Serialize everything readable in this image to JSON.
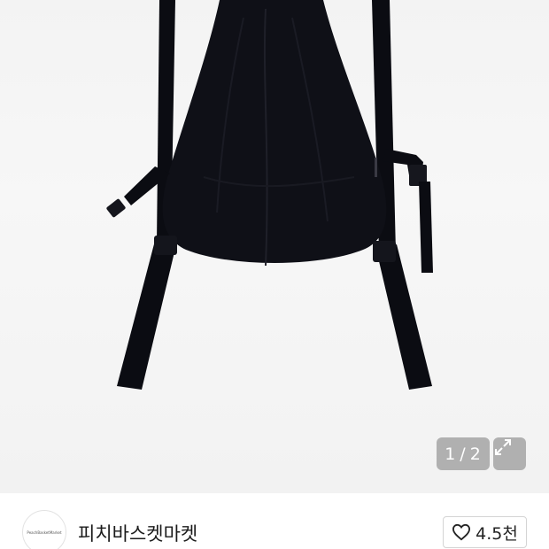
{
  "gallery": {
    "pager": {
      "current": "1",
      "separator": "/",
      "total": "2"
    }
  },
  "shop": {
    "avatar_text": "PeachBasketMarket",
    "name": "피치바스켓마켓",
    "likes_count": "4.5천"
  },
  "icons": {
    "expand": "expand-icon",
    "heart": "heart-outline-icon"
  },
  "colors": {
    "bag": "#0d0e14",
    "badge_bg": "#969696",
    "background": "#f4f4f4"
  }
}
